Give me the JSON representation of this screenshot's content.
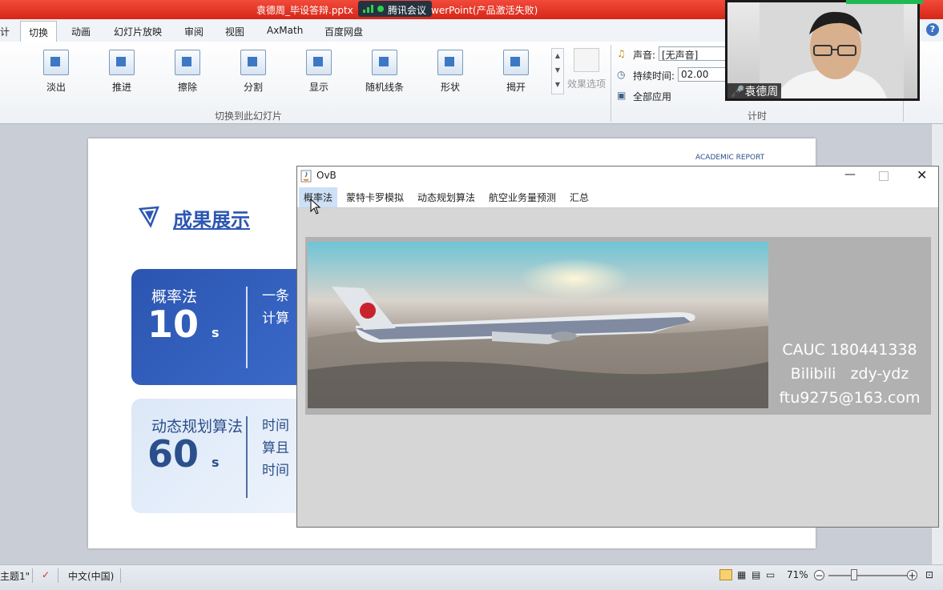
{
  "window": {
    "title_left": "袁德周_毕设答辩.pptx",
    "title_right": "werPoint(产品激活失败)",
    "meeting_badge": "腾讯会议"
  },
  "tabs": [
    {
      "label": "计"
    },
    {
      "label": "切换",
      "active": true
    },
    {
      "label": "动画"
    },
    {
      "label": "幻灯片放映"
    },
    {
      "label": "审阅"
    },
    {
      "label": "视图"
    },
    {
      "label": "AxMath"
    },
    {
      "label": "百度网盘"
    }
  ],
  "ribbon": {
    "transitions": [
      "淡出",
      "推进",
      "擦除",
      "分割",
      "显示",
      "随机线条",
      "形状",
      "揭开"
    ],
    "effect_options": "效果选项",
    "group_label": "切换到此幻灯片",
    "timing": {
      "sound_label": "声音:",
      "sound_value": "[无声音]",
      "duration_label": "持续时间:",
      "duration_value": "02.00",
      "apply_all": "全部应用",
      "group_label": "计时"
    }
  },
  "slide": {
    "academic": "ACADEMIC REPORT",
    "title": "成果展示",
    "cards": [
      {
        "name": "概率法",
        "value": "10",
        "unit": "s",
        "desc_line1": "一条",
        "desc_line2": "计算"
      },
      {
        "name": "动态规划算法",
        "value": "60",
        "unit": "s",
        "desc_line1": "时间",
        "desc_line2": "算且",
        "desc_line3": "时间"
      }
    ]
  },
  "ovb": {
    "title": "OvB",
    "menus": [
      "概率法",
      "蒙特卡罗模拟",
      "动态规划算法",
      "航空业务量预测",
      "汇总"
    ],
    "credits": [
      "CAUC 180441338",
      "Bilibili   zdy-ydz",
      "ftu9275@163.com"
    ]
  },
  "webcam": {
    "name": "袁德周"
  },
  "statusbar": {
    "theme": "主题1\"",
    "language": "中文(中国)",
    "zoom": "71%"
  }
}
